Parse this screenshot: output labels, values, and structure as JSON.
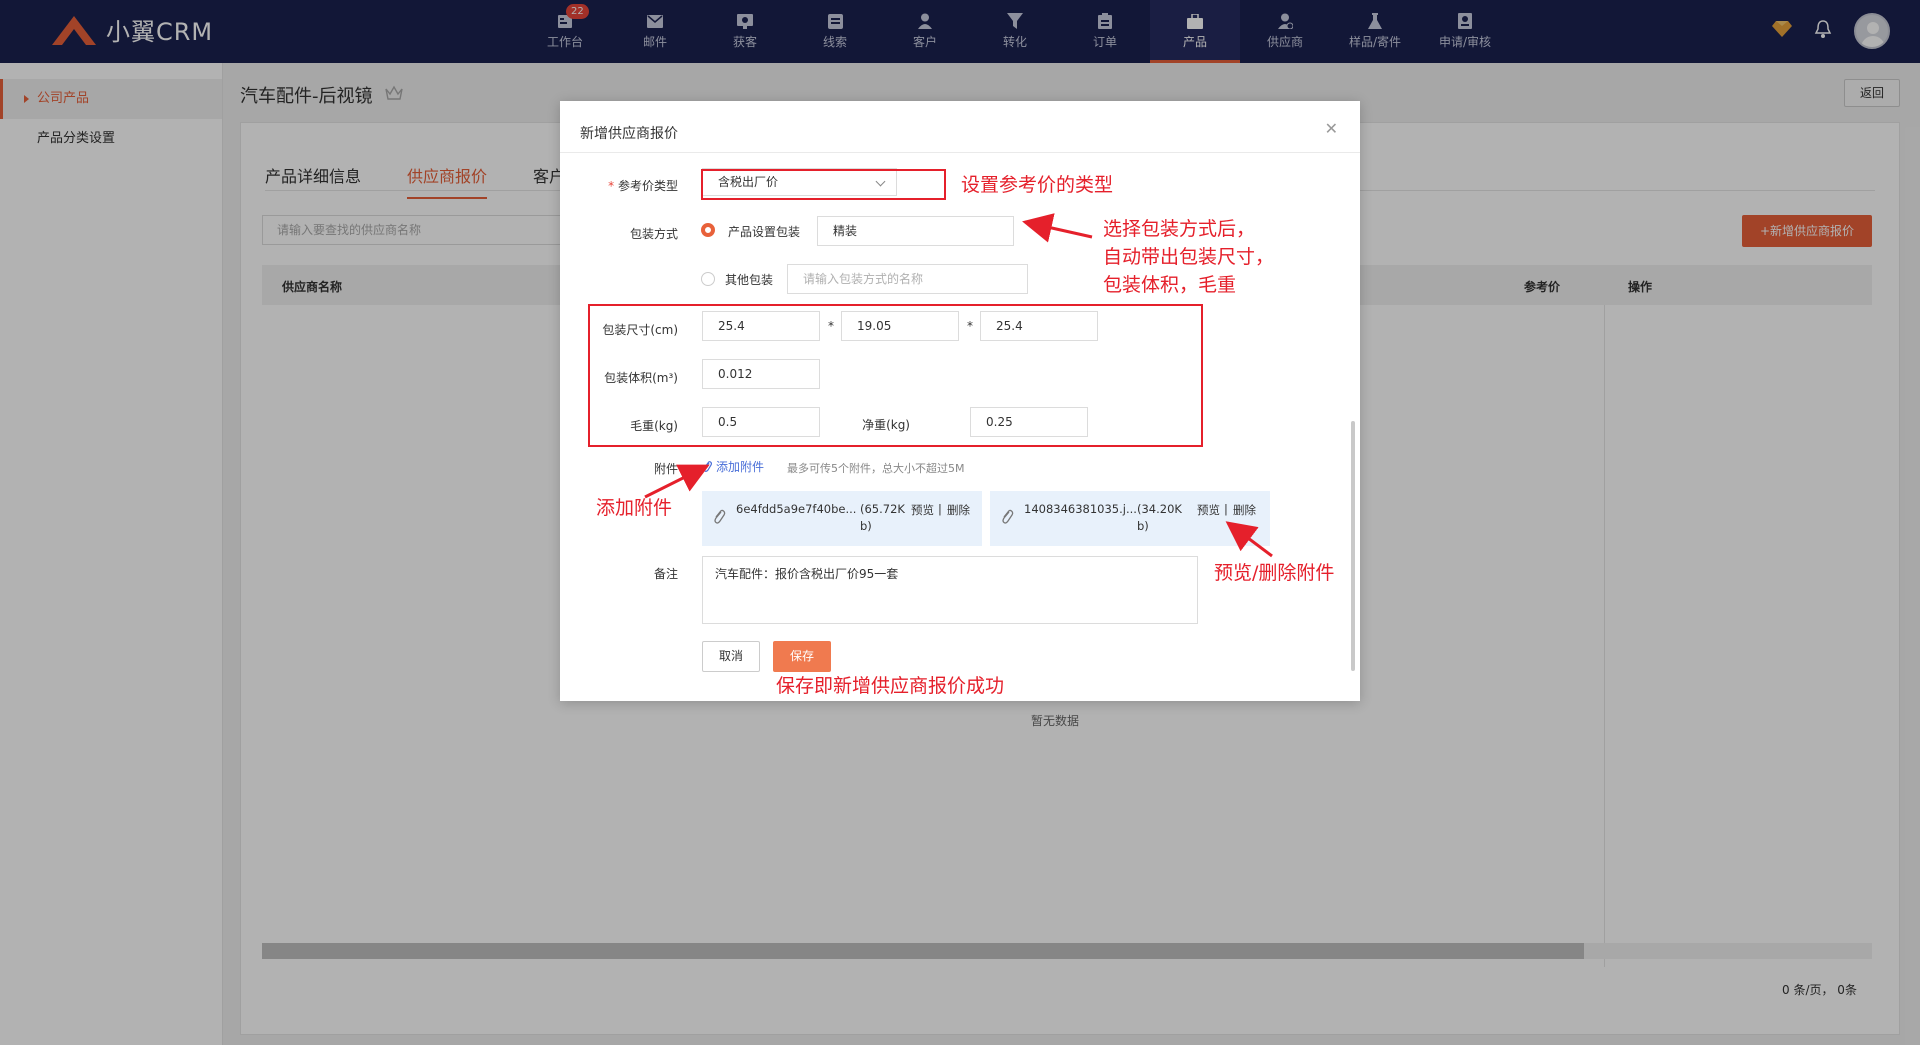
{
  "app": {
    "logo_text": "小翼CRM"
  },
  "nav": {
    "items": [
      {
        "label": "工作台",
        "badge": "22",
        "icon": "dashboard-icon"
      },
      {
        "label": "邮件",
        "icon": "mail-icon"
      },
      {
        "label": "获客",
        "icon": "acquire-icon"
      },
      {
        "label": "线索",
        "icon": "clue-icon"
      },
      {
        "label": "客户",
        "icon": "customer-icon"
      },
      {
        "label": "转化",
        "icon": "funnel-icon"
      },
      {
        "label": "订单",
        "icon": "order-icon"
      },
      {
        "label": "产品",
        "icon": "product-icon",
        "active": true
      },
      {
        "label": "供应商",
        "icon": "supplier-icon"
      },
      {
        "label": "样品/寄件",
        "icon": "sample-icon"
      },
      {
        "label": "申请/审核",
        "icon": "approval-icon"
      }
    ]
  },
  "sidebar": {
    "items": [
      {
        "label": "公司产品",
        "active": true
      },
      {
        "label": "产品分类设置"
      }
    ]
  },
  "page": {
    "title": "汽车配件-后视镜",
    "back_label": "返回"
  },
  "tabs": [
    {
      "label": "产品详细信息"
    },
    {
      "label": "供应商报价",
      "active": true
    },
    {
      "label": "客户"
    }
  ],
  "toolbar": {
    "search_placeholder": "请输入要查找的供应商名称",
    "add_button": "+新增供应商报价"
  },
  "table": {
    "columns": [
      "供应商名称",
      "参考价",
      "操作"
    ],
    "empty_text": "暂无数据"
  },
  "pager": {
    "text": "0 条/页，  0条"
  },
  "modal": {
    "title": "新增供应商报价",
    "ref_type": {
      "label": "参考价类型",
      "value": "含税出厂价"
    },
    "packing": {
      "label": "包装方式",
      "option1_label": "产品设置包装",
      "option1_value": "精装",
      "option2_label": "其他包装",
      "option2_placeholder": "请输入包装方式的名称"
    },
    "size": {
      "label": "包装尺寸(cm)",
      "values": [
        "25.4",
        "19.05",
        "25.4"
      ],
      "sep": "*"
    },
    "volume": {
      "label": "包装体积(m³)",
      "value": "0.012"
    },
    "gross": {
      "label": "毛重(kg)",
      "value": "0.5"
    },
    "net": {
      "label": "净重(kg)",
      "value": "0.25"
    },
    "attachment": {
      "label": "附件",
      "add_link": "添加附件",
      "hint": "最多可传5个附件，总大小不超过5M",
      "files": [
        {
          "name": "6e4fdd5a9e7f40be...",
          "size_line1": "(65.72K",
          "size_line2": "b)",
          "preview": "预览",
          "sep": "|",
          "delete": "删除"
        },
        {
          "name": "1408346381035.j...",
          "size_line1": "(34.20K",
          "size_line2": "b)",
          "preview": "预览",
          "sep": "|",
          "delete": "删除"
        }
      ]
    },
    "remark": {
      "label": "备注",
      "value": "汽车配件：报价含税出厂价95一套"
    },
    "cancel_label": "取消",
    "save_label": "保存"
  },
  "annotations": {
    "ref_type": "设置参考价的类型",
    "packing_lines": [
      "选择包装方式后，",
      "自动带出包装尺寸，",
      "包装体积，毛重"
    ],
    "attach": "添加附件",
    "preview_delete": "预览/删除附件",
    "save": "保存即新增供应商报价成功"
  },
  "colors": {
    "nav_bg": "#1b2150",
    "accent": "#e8613a",
    "annotation": "#e5202b",
    "link": "#4a6fd8"
  }
}
